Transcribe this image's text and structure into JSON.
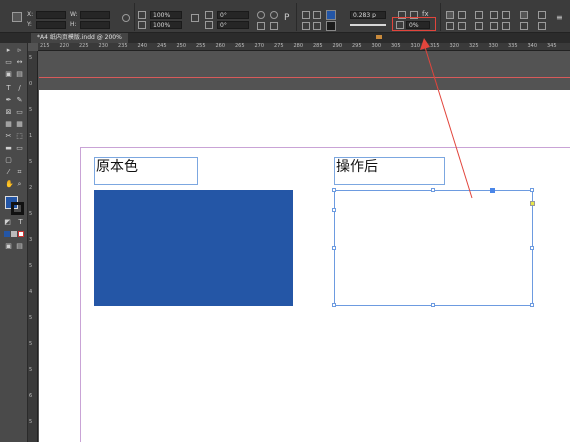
{
  "control_bar": {
    "x_label": "X:",
    "x_value": "",
    "y_label": "Y:",
    "y_value": "",
    "w_label": "W:",
    "w_value": "",
    "h_label": "H:",
    "h_value": "",
    "scale_x": "100%",
    "scale_y": "100%",
    "rotate": "0°",
    "shear": "0°",
    "stroke_weight": "0.283 p",
    "opacity": "0%"
  },
  "tab": {
    "title": "*A4 纸内页模版.indd @ 200%"
  },
  "ruler": {
    "h_ticks": [
      "215",
      "220",
      "225",
      "230",
      "235",
      "240",
      "245",
      "250",
      "255",
      "260",
      "265",
      "270",
      "275",
      "280",
      "285",
      "290",
      "295",
      "300",
      "305",
      "310",
      "315",
      "320",
      "325",
      "330",
      "335",
      "340",
      "345"
    ],
    "v_ticks": [
      "5",
      "0",
      "5",
      "1",
      "5",
      "2",
      "5",
      "3",
      "5",
      "4",
      "5",
      "5",
      "5",
      "6",
      "5"
    ]
  },
  "page": {
    "label_original": "原本色",
    "label_after": "操作后"
  },
  "colors": {
    "fill_swatch": "#2456a6",
    "annotation": "#e2453c",
    "frame_stroke": "#6d9be0"
  }
}
